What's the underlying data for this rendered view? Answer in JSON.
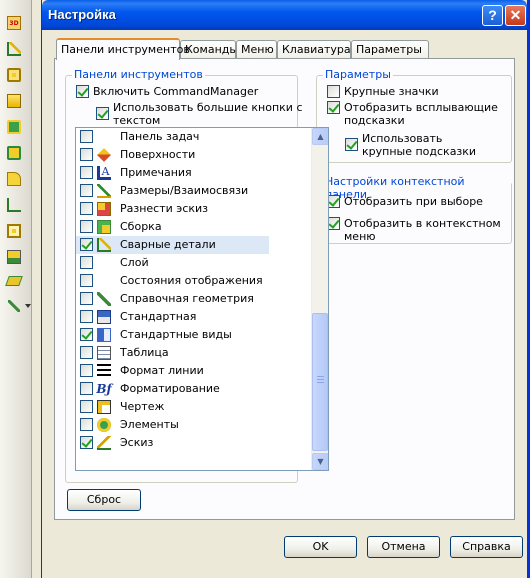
{
  "window": {
    "title": "Настройка",
    "help_glyph": "?",
    "close_glyph": "✕"
  },
  "tabs": [
    {
      "label": "Панели инструментов",
      "active": true
    },
    {
      "label": "Команды"
    },
    {
      "label": "Меню"
    },
    {
      "label": "Клавиатура"
    },
    {
      "label": "Параметры"
    }
  ],
  "toolbars_group": {
    "title": "Панели инструментов",
    "enable_commandmanager": "Включить CommandManager",
    "use_large_buttons_line1": "Использовать большие кнопки с",
    "use_large_buttons_line2": "текстом",
    "items": [
      {
        "label": "Панель задач",
        "checked": false,
        "icon": "taskpane-icon"
      },
      {
        "label": "Поверхности",
        "checked": false,
        "icon": "surfaces-icon"
      },
      {
        "label": "Примечания",
        "checked": false,
        "icon": "annotations-icon"
      },
      {
        "label": "Размеры/Взаимосвязи",
        "checked": false,
        "icon": "dimensions-icon"
      },
      {
        "label": "Разнести эскиз",
        "checked": false,
        "icon": "explode-sketch-icon"
      },
      {
        "label": "Сборка",
        "checked": false,
        "icon": "assembly-icon"
      },
      {
        "label": "Сварные детали",
        "checked": true,
        "icon": "weldments-icon",
        "selected": true
      },
      {
        "label": "Слой",
        "checked": false,
        "icon": "layer-icon"
      },
      {
        "label": "Состояния отображения",
        "checked": false,
        "icon": "display-states-icon"
      },
      {
        "label": "Справочная геометрия",
        "checked": false,
        "icon": "reference-geometry-icon"
      },
      {
        "label": "Стандартная",
        "checked": false,
        "icon": "standard-icon"
      },
      {
        "label": "Стандартные виды",
        "checked": true,
        "icon": "standard-views-icon"
      },
      {
        "label": "Таблица",
        "checked": false,
        "icon": "table-icon"
      },
      {
        "label": "Формат линии",
        "checked": false,
        "icon": "line-format-icon"
      },
      {
        "label": "Форматирование",
        "checked": false,
        "icon": "formatting-icon"
      },
      {
        "label": "Чертеж",
        "checked": false,
        "icon": "drawing-icon"
      },
      {
        "label": "Элементы",
        "checked": false,
        "icon": "features-icon"
      },
      {
        "label": "Эскиз",
        "checked": true,
        "icon": "sketch-icon"
      }
    ]
  },
  "options_group": {
    "title": "Параметры",
    "large_icons": "Крупные значки",
    "show_tooltips_line1": "Отобразить всплывающие",
    "show_tooltips_line2": "подсказки",
    "use_large_tooltips_line1": "Использовать",
    "use_large_tooltips_line2": "крупные подсказки"
  },
  "context_group": {
    "title": "Настройки контекстной панели",
    "show_on_selection": "Отобразить при выборе",
    "show_in_context_menu": "Отобразить в контекстном меню"
  },
  "buttons": {
    "reset": "Сброс",
    "ok": "OK",
    "cancel": "Отмена",
    "help": "Справка"
  },
  "colors": {
    "title_bar": "#0058ee",
    "group_title": "#0046d5",
    "selection": "#dde8f7",
    "active_tab_accent": "#e68b2c"
  }
}
